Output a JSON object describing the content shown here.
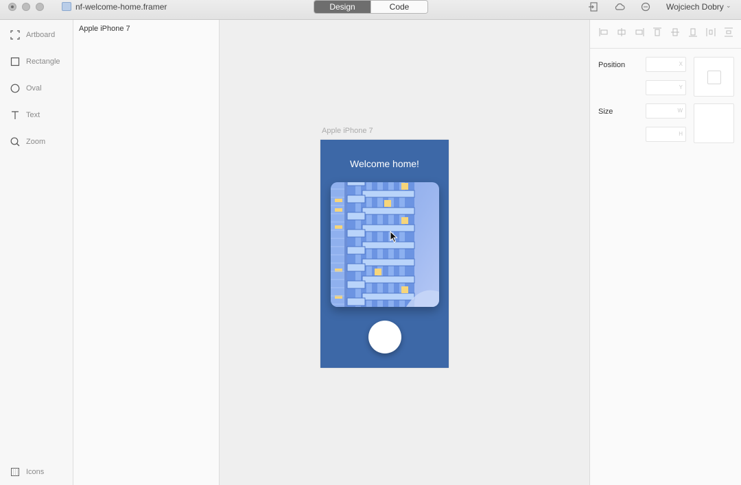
{
  "window": {
    "doc_title": "nf-welcome-home.framer",
    "tabs": [
      {
        "label": "Design",
        "active": true
      },
      {
        "label": "Code",
        "active": false
      }
    ],
    "user_name": "Wojciech Dobry",
    "toolbar_icons": [
      "exit-icon",
      "cloud-icon",
      "chat-icon"
    ]
  },
  "tools": {
    "items": [
      {
        "label": "Artboard",
        "icon": "artboard-icon"
      },
      {
        "label": "Rectangle",
        "icon": "rectangle-icon"
      },
      {
        "label": "Oval",
        "icon": "oval-icon"
      },
      {
        "label": "Text",
        "icon": "text-icon"
      },
      {
        "label": "Zoom",
        "icon": "zoom-icon"
      }
    ],
    "bottom_label": "Icons"
  },
  "layers": {
    "items": [
      "Apple iPhone 7"
    ]
  },
  "canvas": {
    "artboard_label": "Apple iPhone 7",
    "welcome_text": "Welcome home!",
    "background_color": "#3d68a7"
  },
  "inspector": {
    "position_label": "Position",
    "size_label": "Size",
    "fields": {
      "x": "X",
      "y": "Y",
      "w": "W",
      "h": "H"
    }
  }
}
